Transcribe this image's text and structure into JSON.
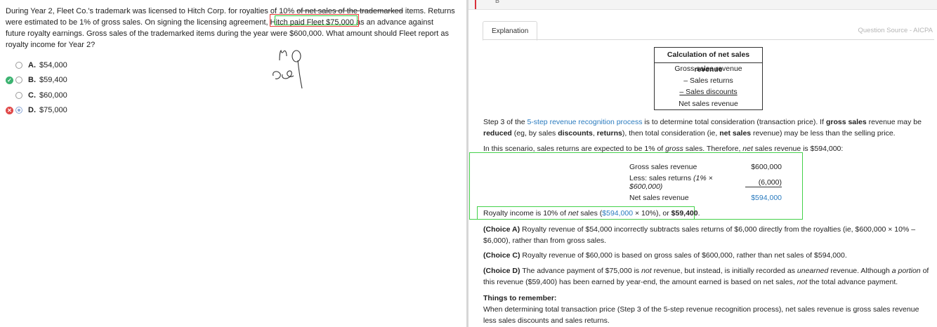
{
  "question": {
    "part1": "During Year 2, Fleet Co.'s trademark was licensed to Hitch Corp. for royalties of 10% ",
    "part2": "of net sales of the trademarked",
    "part3": " items.  Returns were estimated to be 1% of gross sales.  On signing the licensing agreement, Hitch paid Fleet $75,000 as an advance against future royalty earnings.  Gross sales of the trademarked items during the year were $600,000.  What amount should Fleet report as royalty income for Year 2?"
  },
  "choices": [
    {
      "letter": "A.",
      "text": "$54,000",
      "status": "none",
      "selected": false
    },
    {
      "letter": "B.",
      "text": "$59,400",
      "status": "correct",
      "selected": false
    },
    {
      "letter": "C.",
      "text": "$60,000",
      "status": "none",
      "selected": false
    },
    {
      "letter": "D.",
      "text": "$75,000",
      "status": "wrong",
      "selected": true
    }
  ],
  "top_strip": {
    "caret": "B"
  },
  "explanation": {
    "tab_label": "Explanation",
    "source": "Question Source - AICPA",
    "calc_table": {
      "title": "Calculation of net sales revenue",
      "rows": [
        "Gross sales revenue",
        "– Sales returns",
        "– Sales discounts",
        "Net sales revenue"
      ]
    },
    "step3": {
      "a": "Step 3 of the ",
      "link": "5-step revenue recognition process",
      "b": " is to determine total consideration (transaction price).  If ",
      "c": "gross sales",
      "d": " revenue may be ",
      "e": "reduced",
      "f": " (eg, by sales ",
      "g": "discounts",
      "h": ", ",
      "i": "returns",
      "j": "), then total consideration (ie, ",
      "k": "net sales",
      "l": " revenue) may be less than the selling price."
    },
    "scenario": {
      "a": "In this scenario, sales returns are expected to be 1% of ",
      "b": "gross",
      "c": " sales.  Therefore, ",
      "d": "net",
      "e": " sales revenue is $594,000:"
    },
    "net_table": [
      {
        "label": "Gross sales revenue",
        "italic": "",
        "value": "$600,000"
      },
      {
        "label": "Less: sales returns ",
        "italic": "(1% × $600,000)",
        "value": "(6,000)"
      },
      {
        "label": "Net sales revenue",
        "italic": "",
        "value": "$594,000"
      }
    ],
    "royalty": {
      "a": "Royalty income is 10% of ",
      "b": "net",
      "c": " sales (",
      "d": "$594,000",
      "e": " × 10%), or ",
      "f": "$59,400",
      "g": "."
    },
    "choiceA": {
      "label": "(Choice A)",
      "text": "  Royalty revenue of $54,000 incorrectly subtracts sales returns of $6,000 directly from the royalties (ie, $600,000 × 10% – $6,000), rather than from gross sales."
    },
    "choiceC": {
      "label": "(Choice C)",
      "text": "  Royalty revenue of $60,000 is based on gross sales of $600,000, rather than net sales of $594,000."
    },
    "choiceD": {
      "label": "(Choice D)",
      "a": "  The advance payment of $75,000 is ",
      "b": "not",
      "c": " revenue, but instead, is initially recorded as ",
      "d": "unearned",
      "e": " revenue.  Although ",
      "f": "a portion",
      "g": " of this revenue ($59,400) has been earned by year-end, the amount earned is based on net sales, ",
      "h": "not",
      "i": " the total advance payment."
    },
    "things_heading": "Things to remember:",
    "things_text": "When determining total transaction price (Step 3 of the 5-step revenue recognition process), net sales revenue is gross sales revenue less sales discounts and sales returns."
  },
  "colors": {
    "link": "#2a7bbf",
    "correct": "#3cb371",
    "wrong": "#e04848",
    "highlight_green": "#44d14a",
    "highlight_red": "#e53935"
  }
}
